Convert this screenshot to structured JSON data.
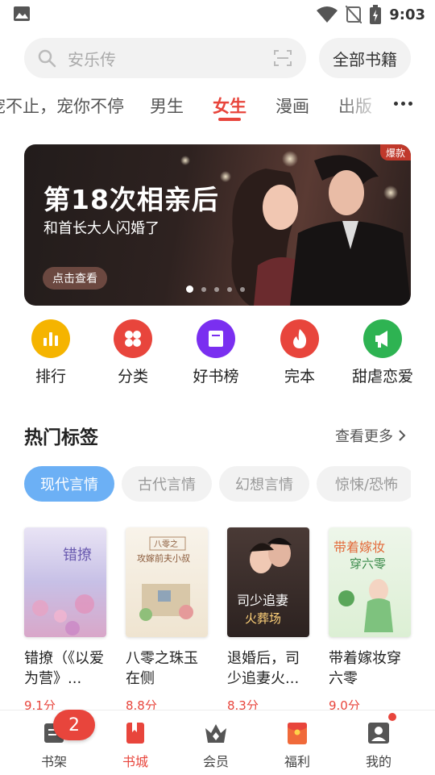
{
  "status_bar": {
    "time": "9:03"
  },
  "search": {
    "placeholder": "安乐传",
    "all_books_label": "全部书籍"
  },
  "tabs": [
    {
      "label": "宠不止，宠你不停"
    },
    {
      "label": "男生"
    },
    {
      "label": "女生",
      "active": true
    },
    {
      "label": "漫画"
    },
    {
      "label": "出版"
    }
  ],
  "banner": {
    "title": "第18次相亲后",
    "subtitle": "和首长大人闪婚了",
    "button_label": "点击查看",
    "badge": "爆款",
    "dot_count": 5,
    "active_dot": 0
  },
  "quick_entries": [
    {
      "label": "排行",
      "icon": "bar-chart-icon",
      "color": "#f5b400"
    },
    {
      "label": "分类",
      "icon": "grid-icon",
      "color": "#e8453c"
    },
    {
      "label": "好书榜",
      "icon": "book-icon",
      "color": "#7a2ff0"
    },
    {
      "label": "完本",
      "icon": "fire-icon",
      "color": "#e8453c"
    },
    {
      "label": "甜虐恋爱",
      "icon": "megaphone-icon",
      "color": "#2eb352"
    }
  ],
  "hot_tags": {
    "title": "热门标签",
    "see_more": "查看更多",
    "chips": [
      {
        "label": "现代言情",
        "active": true
      },
      {
        "label": "古代言情"
      },
      {
        "label": "幻想言情"
      },
      {
        "label": "惊悚/恐怖"
      }
    ]
  },
  "books": [
    {
      "title": "错撩（《以爱为营》...",
      "score": "9.1分"
    },
    {
      "title": "八零之珠玉在侧",
      "score": "8.8分"
    },
    {
      "title": "退婚后，司少追妻火...",
      "score": "8.3分"
    },
    {
      "title": "带着嫁妆穿六零",
      "score": "9.0分"
    }
  ],
  "bottom_nav": {
    "badge_count": "2",
    "items": [
      {
        "label": "书架",
        "icon": "bookshelf-icon"
      },
      {
        "label": "书城",
        "icon": "bookmark-icon",
        "active": true
      },
      {
        "label": "会员",
        "icon": "crown-icon"
      },
      {
        "label": "福利",
        "icon": "red-envelope-icon"
      },
      {
        "label": "我的",
        "icon": "profile-icon"
      }
    ]
  }
}
